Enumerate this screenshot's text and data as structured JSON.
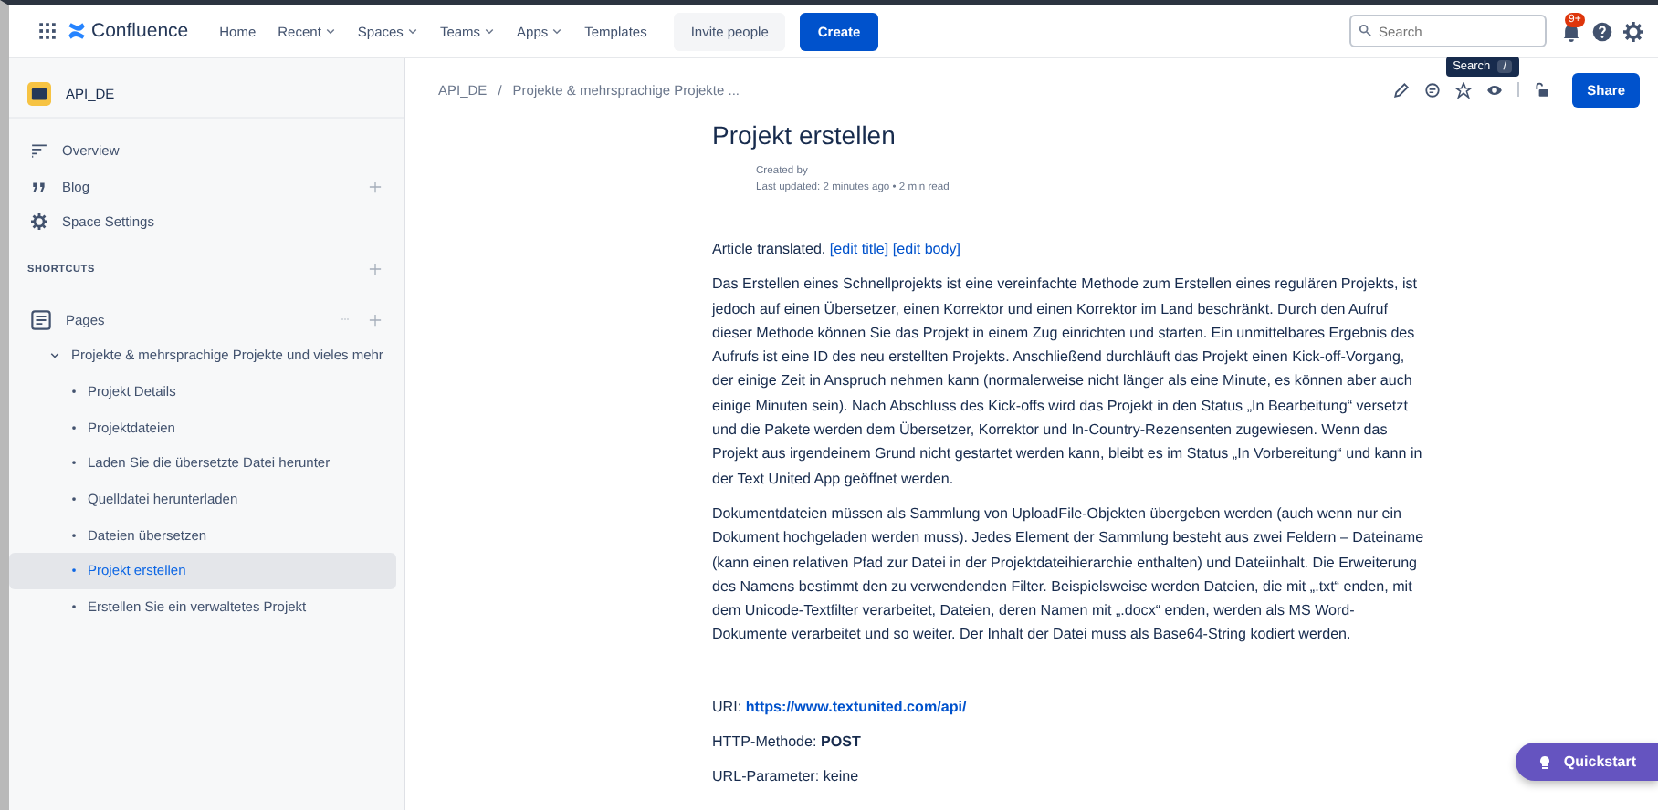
{
  "topnav": {
    "product": "Confluence",
    "items": [
      {
        "label": "Home",
        "has_menu": false
      },
      {
        "label": "Recent",
        "has_menu": true
      },
      {
        "label": "Spaces",
        "has_menu": true
      },
      {
        "label": "Teams",
        "has_menu": true
      },
      {
        "label": "Apps",
        "has_menu": true
      },
      {
        "label": "Templates",
        "has_menu": false
      }
    ],
    "invite": "Invite people",
    "create": "Create",
    "search": {
      "placeholder": "Search"
    },
    "notification_badge": "9+",
    "tooltip": {
      "label": "Search",
      "key": "/"
    }
  },
  "sidebar": {
    "space": "API_DE",
    "items": [
      {
        "label": "Overview",
        "kind": "overview",
        "addable": false
      },
      {
        "label": "Blog",
        "kind": "blog",
        "addable": true
      },
      {
        "label": "Space Settings",
        "kind": "settings",
        "addable": false
      }
    ],
    "shortcuts": "SHORTCUTS",
    "pages": "Pages",
    "tree": [
      {
        "label": "Projekte & mehrsprachige Projekte und vieles mehr",
        "expanded": true,
        "selected": false,
        "children": [
          {
            "label": "Projekt Details",
            "selected": false
          },
          {
            "label": "Projektdateien",
            "selected": false
          },
          {
            "label": "Laden Sie die übersetzte Datei herunter",
            "selected": false
          },
          {
            "label": "Quelldatei herunterladen",
            "selected": false
          },
          {
            "label": "Dateien übersetzen",
            "selected": false
          },
          {
            "label": "Projekt erstellen",
            "selected": true
          },
          {
            "label": "Erstellen Sie ein verwaltetes Projekt",
            "selected": false
          }
        ]
      }
    ]
  },
  "page": {
    "breadcrumb": [
      "API_DE",
      "Projekte & mehrsprachige Projekte ..."
    ],
    "breadcrumb_separator": "/",
    "share": "Share",
    "title": "Projekt erstellen",
    "created_by": "Created by",
    "last_updated": "Last updated: 2 minutes ago • 2 min read",
    "note": {
      "text": "Article translated.",
      "links": [
        "[edit title]",
        "[edit body]"
      ]
    },
    "paragraphs": [
      "Das Erstellen eines Schnellprojekts ist eine vereinfachte Methode zum Erstellen eines regulären Projekts, ist jedoch auf einen Übersetzer, einen Korrektor und einen Korrektor im Land beschränkt. Durch den Aufruf dieser Methode können Sie das Projekt in einem Zug einrichten und starten. Ein unmittelbares Ergebnis des Aufrufs ist eine ID des neu erstellten Projekts. Anschließend durchläuft das Projekt einen Kick-off-Vorgang, der einige Zeit in Anspruch nehmen kann (normalerweise nicht länger als eine Minute, es können aber auch einige Minuten sein). Nach Abschluss des Kick-offs wird das Projekt in den Status „In Bearbeitung“ versetzt und die Pakete werden dem Übersetzer, Korrektor und In-Country-Rezensenten zugewiesen. Wenn das Projekt aus irgendeinem Grund nicht gestartet werden kann, bleibt es im Status „In Vorbereitung“ und kann in der Text United App geöffnet werden.",
      "Dokumentdateien müssen als Sammlung von UploadFile-Objekten übergeben werden (auch wenn nur ein Dokument hochgeladen werden muss). Jedes Element der Sammlung besteht aus zwei Feldern – Dateiname (kann einen relativen Pfad zur Datei in der Projektdateihierarchie enthalten) und Dateiinhalt. Die Erweiterung des Namens bestimmt den zu verwendenden Filter. Beispielsweise werden Dateien, die mit „.txt“ enden, mit dem Unicode-Textfilter verarbeitet, Dateien, deren Namen mit „.docx“ enden, werden als MS Word-Dokumente verarbeitet und so weiter. Der Inhalt der Datei muss als Base64-String kodiert werden."
    ],
    "uri": {
      "label": "URI:",
      "url": "https://www.textunited.com/api/"
    },
    "method": "HTTP-Methode: **POST**",
    "params": "URL-Parameter: keine"
  },
  "quickstart": "Quickstart"
}
